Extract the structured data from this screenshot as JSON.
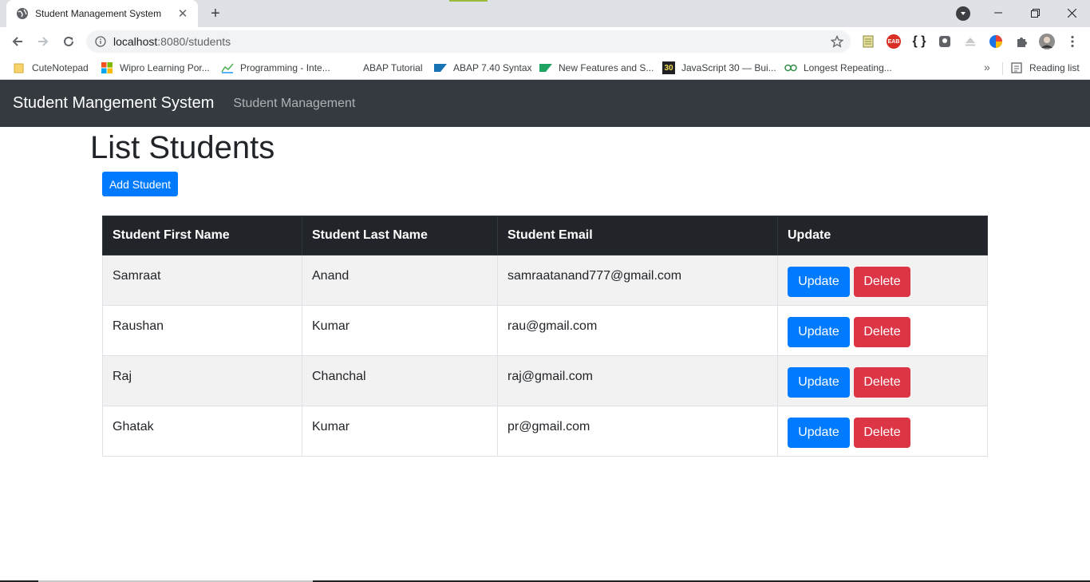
{
  "browser": {
    "tab_title": "Student Management System",
    "url_host": "localhost",
    "url_rest": ":8080/students",
    "bookmarks": [
      {
        "label": "CuteNotepad",
        "icon": "folder-icon"
      },
      {
        "label": "Wipro Learning Por...",
        "icon": "windows-logo-icon"
      },
      {
        "label": "Programming - Inte...",
        "icon": "chart-icon"
      },
      {
        "label": "ABAP Tutorial",
        "icon": "blank-icon"
      },
      {
        "label": "ABAP 7.40 Syntax",
        "icon": "sap-icon"
      },
      {
        "label": "New Features and S...",
        "icon": "sap-icon"
      },
      {
        "label": "JavaScript 30 — Bui...",
        "icon": "js30-icon"
      },
      {
        "label": "Longest Repeating...",
        "icon": "gfg-icon"
      }
    ],
    "js30_badge": "30",
    "ext_eab": "EAB",
    "ext_json": "{ }",
    "reading_list": "Reading list",
    "more_bookmarks": "»"
  },
  "navbar": {
    "brand": "Student Mangement System",
    "link": "Student Management"
  },
  "main": {
    "title": "List Students",
    "add_button": "Add Student",
    "columns": [
      "Student First Name",
      "Student Last Name",
      "Student Email",
      "Update"
    ],
    "rows": [
      {
        "first": "Samraat",
        "last": "Anand",
        "email": "samraatanand777@gmail.com"
      },
      {
        "first": "Raushan",
        "last": "Kumar",
        "email": "rau@gmail.com"
      },
      {
        "first": "Raj",
        "last": "Chanchal",
        "email": "raj@gmail.com"
      },
      {
        "first": "Ghatak",
        "last": "Kumar",
        "email": "pr@gmail.com"
      }
    ],
    "update_label": "Update",
    "delete_label": "Delete"
  },
  "colors": {
    "navbar": "#343a40",
    "primary": "#007bff",
    "danger": "#dc3545",
    "table_head": "#212529"
  }
}
